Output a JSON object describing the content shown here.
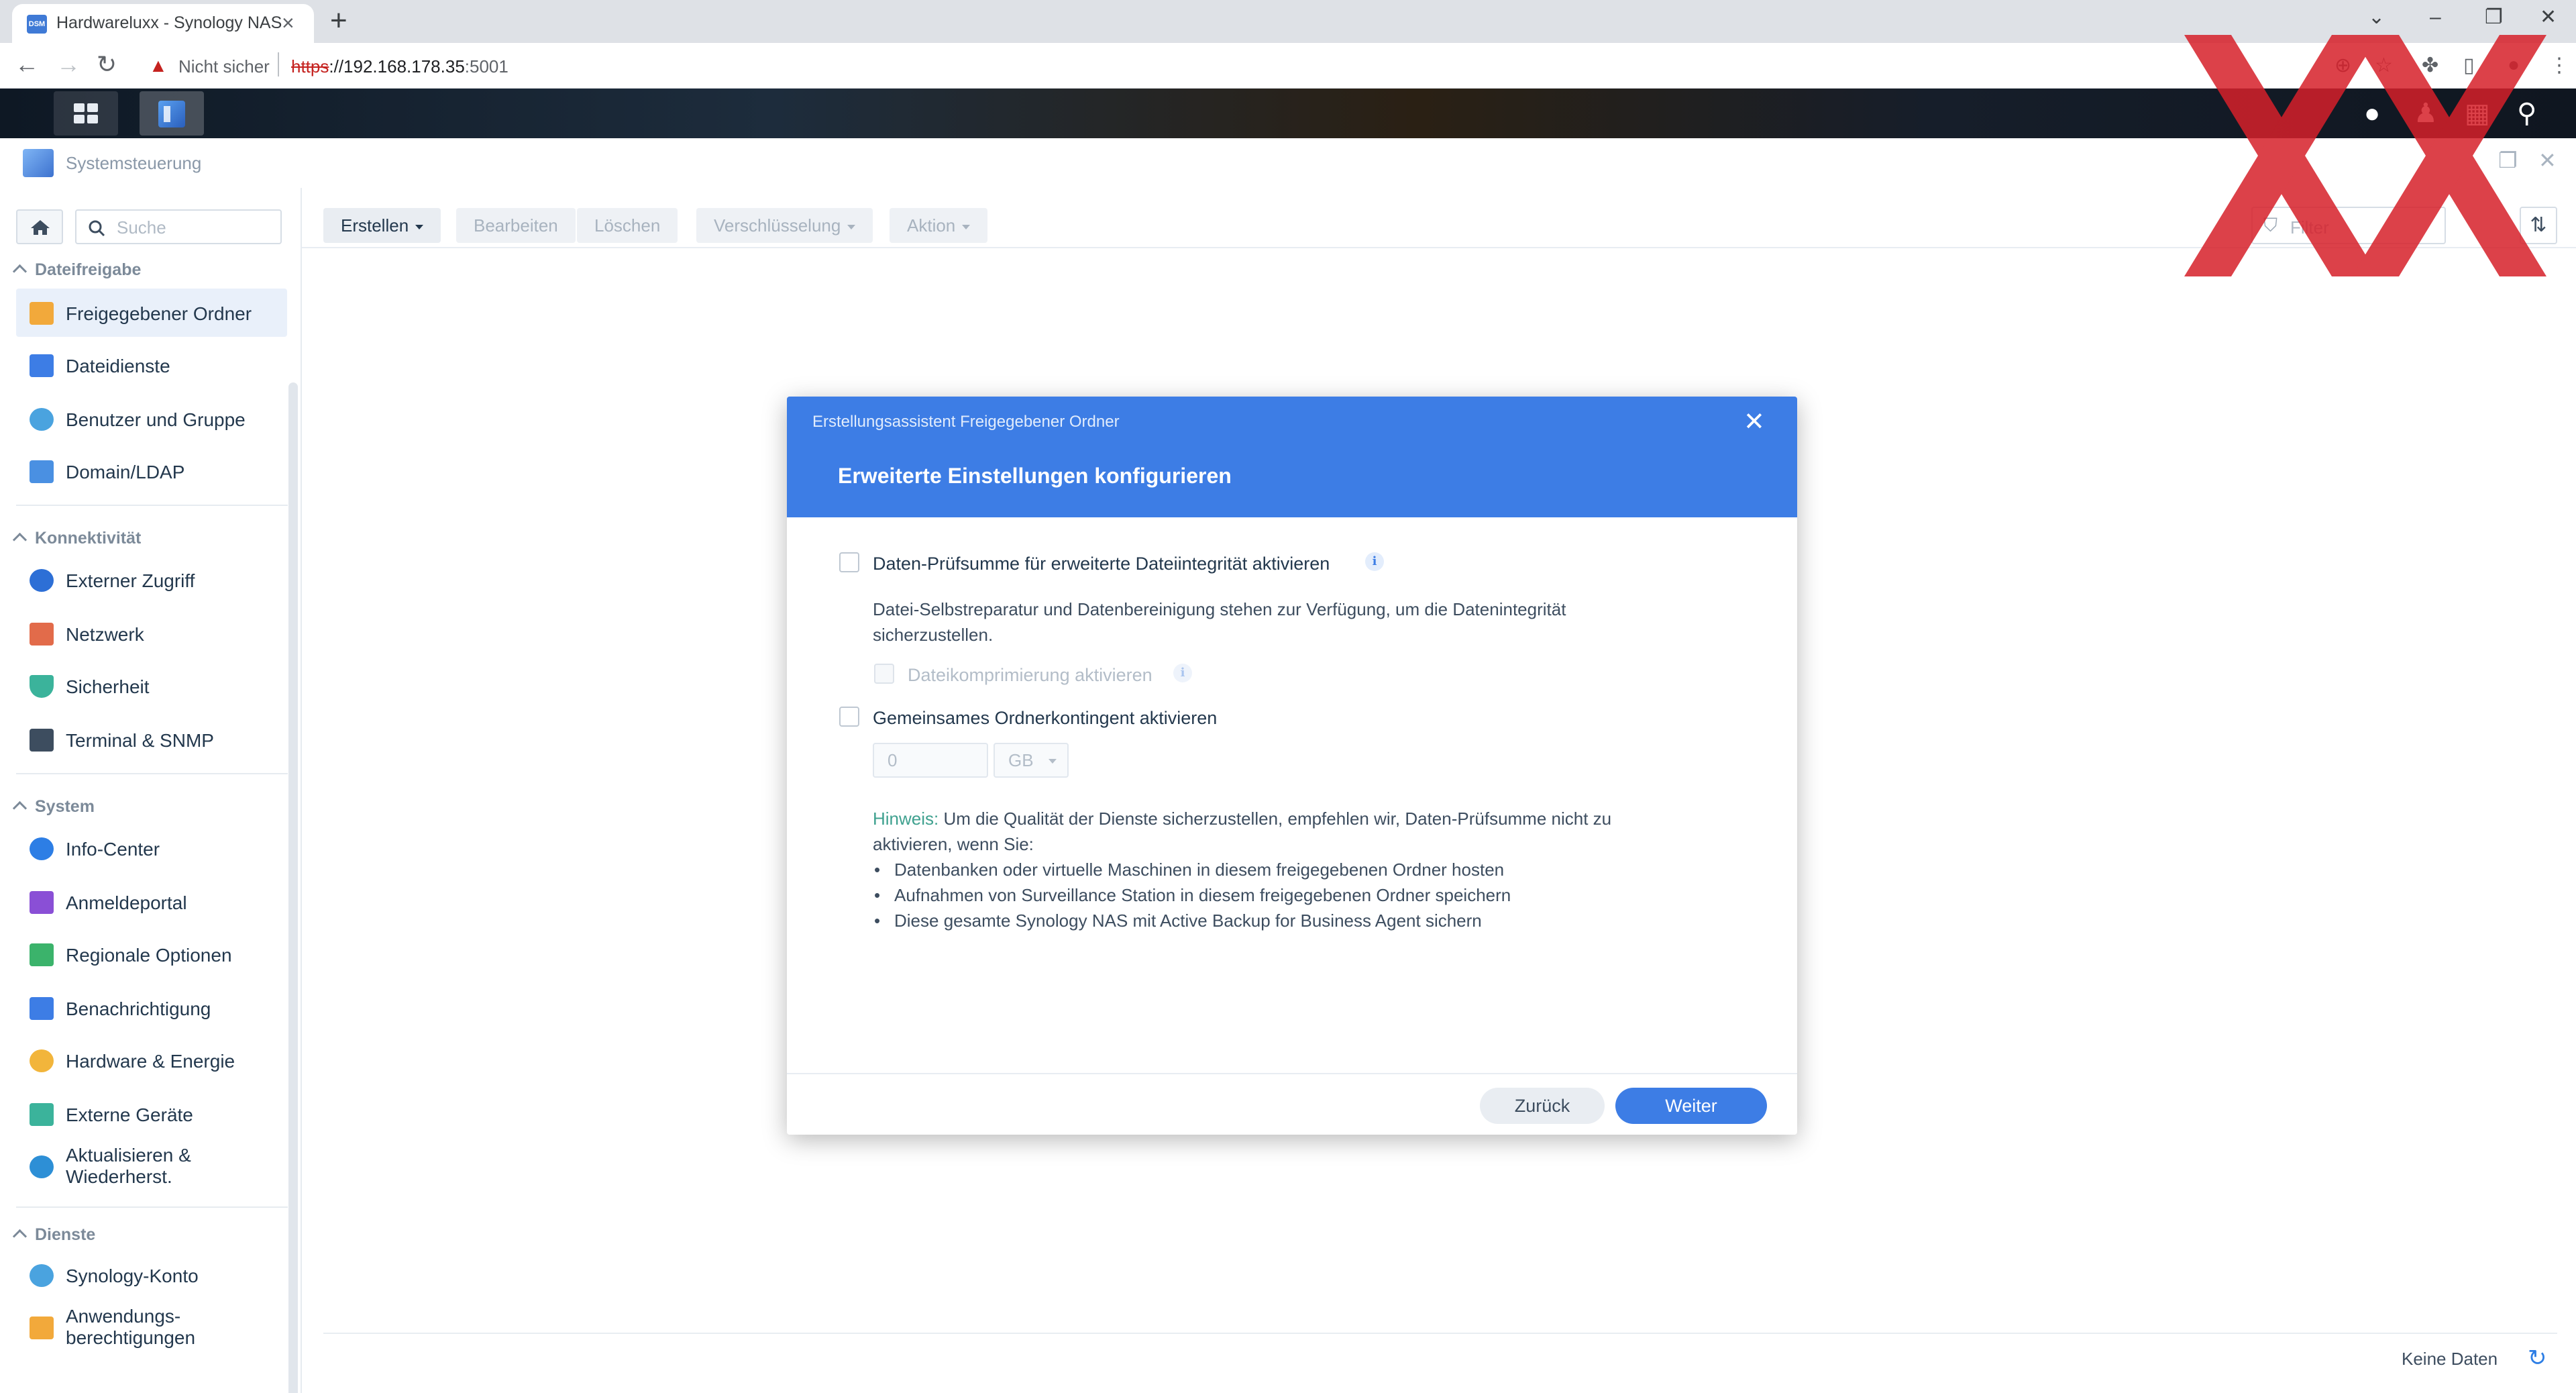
{
  "browser": {
    "tab_title": "Hardwareluxx - Synology NAS",
    "tab_favicon_text": "DSM",
    "not_secure": "Nicht sicher",
    "url_scheme": "https",
    "url_host": "://192.168.178.35",
    "url_port": ":5001"
  },
  "window": {
    "title": "Systemsteuerung"
  },
  "sidebar": {
    "search_placeholder": "Suche",
    "sections": [
      {
        "label": "Dateifreigabe"
      },
      {
        "label": "Konnektivität"
      },
      {
        "label": "System"
      },
      {
        "label": "Dienste"
      }
    ],
    "items": [
      {
        "label": "Freigegebener Ordner",
        "color": "#f2a93b"
      },
      {
        "label": "Dateidienste",
        "color": "#3d7de5"
      },
      {
        "label": "Benutzer und Gruppe",
        "color": "#4aa3df"
      },
      {
        "label": "Domain/LDAP",
        "color": "#4a90e2"
      },
      {
        "label": "Externer Zugriff",
        "color": "#2d6fd6"
      },
      {
        "label": "Netzwerk",
        "color": "#e26b4a"
      },
      {
        "label": "Sicherheit",
        "color": "#3bb39b"
      },
      {
        "label": "Terminal & SNMP",
        "color": "#3d4d5f"
      },
      {
        "label": "Info-Center",
        "color": "#2d7ee5"
      },
      {
        "label": "Anmeldeportal",
        "color": "#8a4fd6"
      },
      {
        "label": "Regionale Optionen",
        "color": "#3bb36b"
      },
      {
        "label": "Benachrichtigung",
        "color": "#3d7de5"
      },
      {
        "label": "Hardware & Energie",
        "color": "#f2b53b"
      },
      {
        "label": "Externe Geräte",
        "color": "#3bb39b"
      },
      {
        "label": "Aktualisieren & Wiederherst.",
        "color": "#2d8fd6"
      },
      {
        "label": "Synology-Konto",
        "color": "#4aa3df"
      },
      {
        "label": "Anwendungs-berechtigungen",
        "color": "#f2a93b"
      }
    ]
  },
  "toolbar": {
    "create": "Erstellen",
    "edit": "Bearbeiten",
    "delete": "Löschen",
    "encryption": "Verschlüsselung",
    "action": "Aktion",
    "filter_placeholder": "Filter"
  },
  "footer": {
    "status": "Keine Daten"
  },
  "dialog": {
    "wizard_title": "Erstellungsassistent Freigegebener Ordner",
    "heading": "Erweiterte Einstellungen konfigurieren",
    "checksum_label": "Daten-Prüfsumme für erweiterte Dateiintegrität aktivieren",
    "checksum_desc": "Datei-Selbstreparatur und Datenbereinigung stehen zur Verfügung, um die Datenintegrität sicherzustellen.",
    "compression_label": "Dateikomprimierung aktivieren",
    "quota_label": "Gemeinsames Ordnerkontingent aktivieren",
    "quota_value": "0",
    "quota_unit": "GB",
    "hint_key": "Hinweis:",
    "hint_text": " Um die Qualität der Dienste sicherzustellen, empfehlen wir, Daten-Prüfsumme nicht zu aktivieren, wenn Sie:",
    "hint_bullets": [
      "Datenbanken oder virtuelle Maschinen in diesem freigegebenen Ordner hosten",
      "Aufnahmen von Surveillance Station in diesem freigegebenen Ordner speichern",
      "Diese gesamte Synology NAS mit Active Backup for Business Agent sichern"
    ],
    "back_button": "Zurück",
    "next_button": "Weiter"
  },
  "colors": {
    "accent": "#3d7de5",
    "hint": "#3fa18f",
    "logo_red": "#d6202a"
  }
}
